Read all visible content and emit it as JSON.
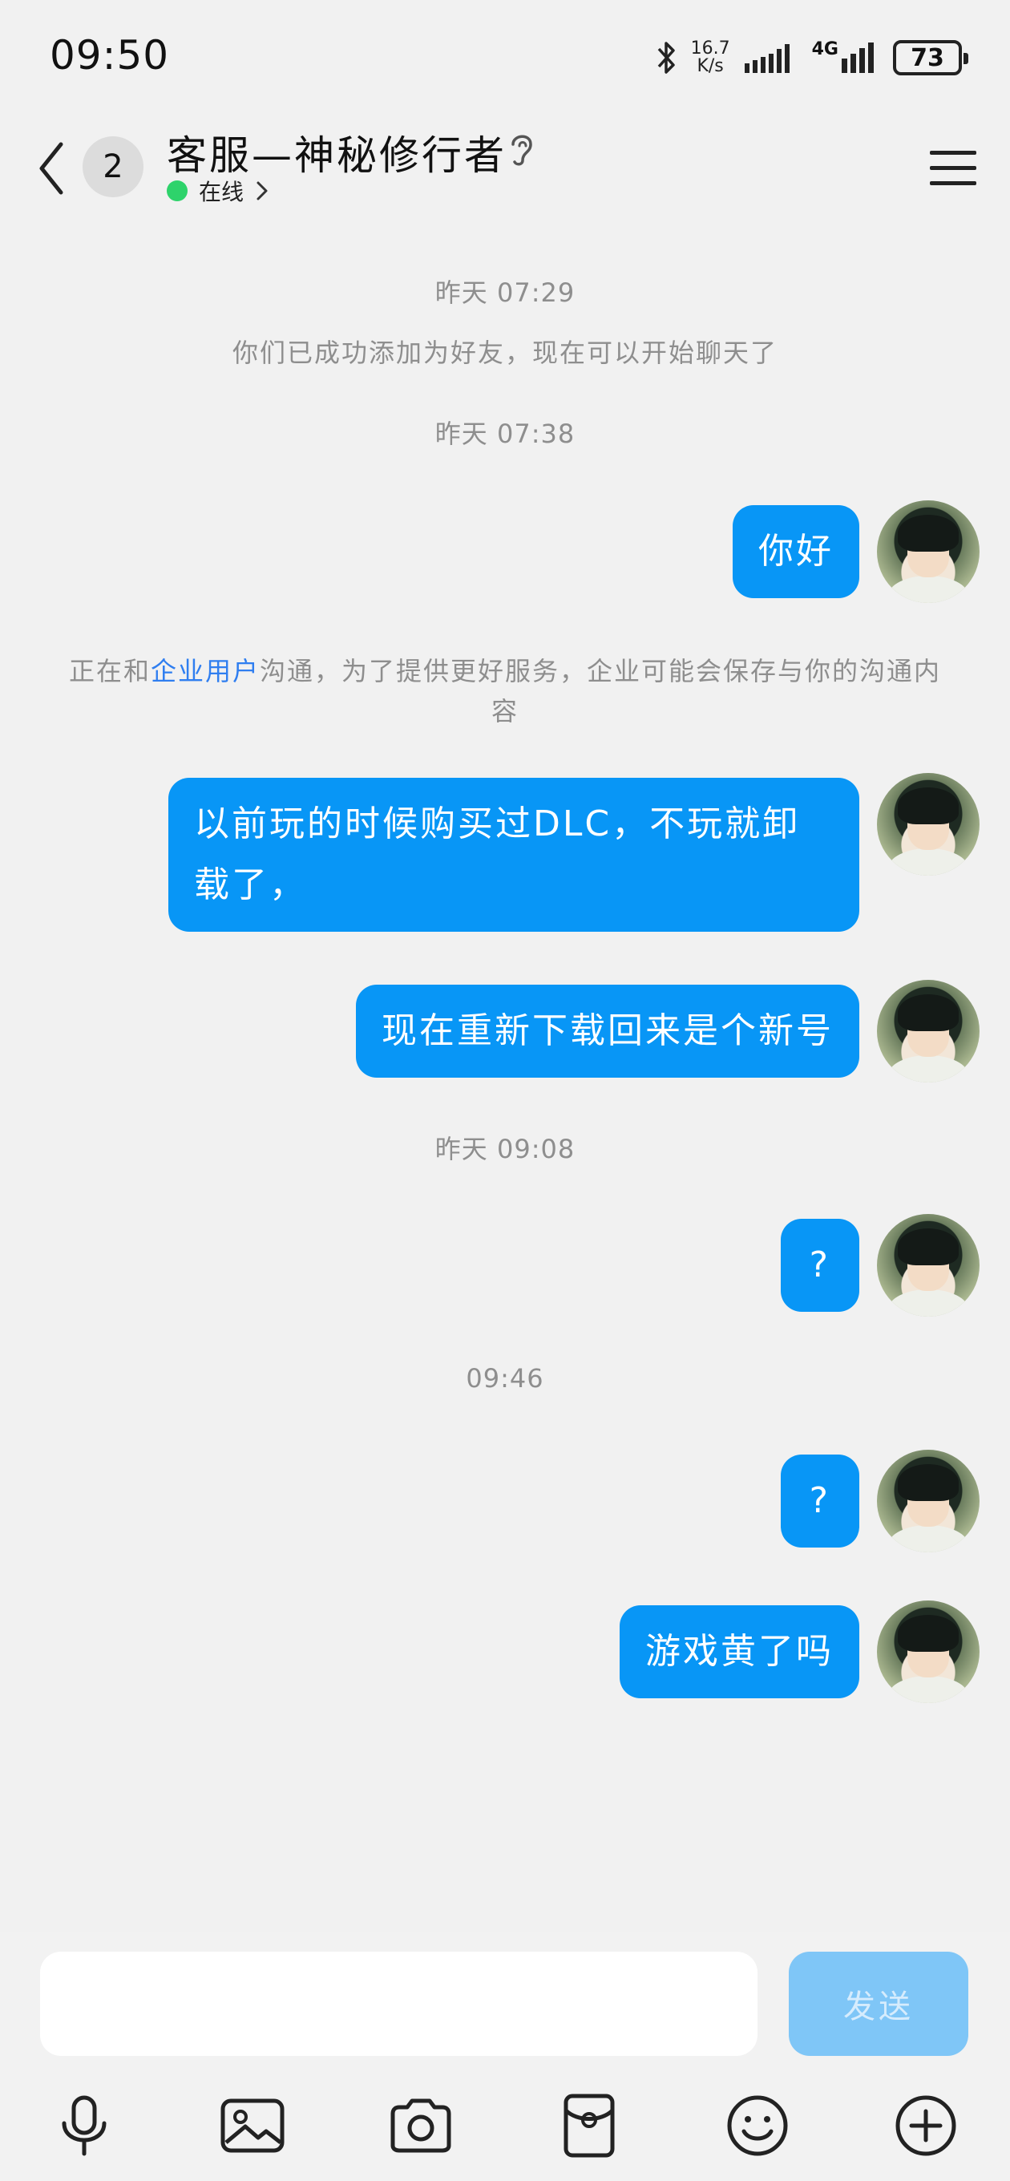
{
  "status_bar": {
    "time": "09:50",
    "speed_value": "16.7",
    "speed_unit": "K/s",
    "network": "4G",
    "battery": "73"
  },
  "header": {
    "unread_count": "2",
    "contact_name": "客服—神秘修行者",
    "status": "在线"
  },
  "messages": [
    {
      "type": "time",
      "text": "昨天 07:29"
    },
    {
      "type": "system",
      "text": "你们已成功添加为好友，现在可以开始聊天了"
    },
    {
      "type": "time",
      "text": "昨天 07:38"
    },
    {
      "type": "sent",
      "text": "你好"
    },
    {
      "type": "notice",
      "prefix": "正在和",
      "link": "企业用户",
      "suffix": "沟通，为了提供更好服务，企业可能会保存与你的沟通内容"
    },
    {
      "type": "sent",
      "text": "以前玩的时候购买过DLC，不玩就卸载了，"
    },
    {
      "type": "sent",
      "text": "现在重新下载回来是个新号"
    },
    {
      "type": "time",
      "text": "昨天 09:08"
    },
    {
      "type": "sent",
      "text": "?"
    },
    {
      "type": "time",
      "text": "09:46"
    },
    {
      "type": "sent",
      "text": "?"
    },
    {
      "type": "sent",
      "text": "游戏黄了吗"
    }
  ],
  "input": {
    "value": "",
    "send_label": "发送"
  },
  "toolbar_icons": [
    "microphone-icon",
    "image-icon",
    "camera-icon",
    "red-packet-icon",
    "emoji-icon",
    "plus-icon"
  ],
  "colors": {
    "bubble": "#0896f6",
    "send_disabled": "#7fc6f7",
    "online": "#2ed36b",
    "link": "#2f7ef0"
  }
}
